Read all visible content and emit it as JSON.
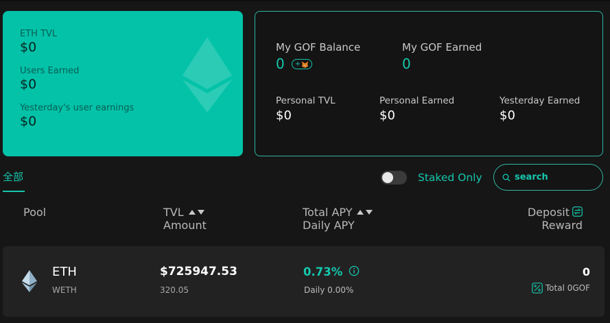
{
  "overview": {
    "eth_tvl_label": "ETH TVL",
    "eth_tvl_value": "$0",
    "users_earned_label": "Users Earned",
    "users_earned_value": "$0",
    "yesterday_label": "Yesterday's user earnings",
    "yesterday_value": "$0"
  },
  "account": {
    "gof_balance_label": "My GOF Balance",
    "gof_balance_value": "0",
    "add_token_label": "+",
    "gof_earned_label": "My GOF Earned",
    "gof_earned_value": "0",
    "personal_tvl_label": "Personal TVL",
    "personal_tvl_value": "$0",
    "personal_earned_label": "Personal Earned",
    "personal_earned_value": "$0",
    "yesterday_earned_label": "Yesterday Earned",
    "yesterday_earned_value": "$0"
  },
  "filters": {
    "tab_all": "全部",
    "staked_only_label": "Staked Only",
    "staked_only": false,
    "search_placeholder": "search"
  },
  "table": {
    "headers": {
      "pool": "Pool",
      "tvl": "TVL",
      "amount": "Amount",
      "total_apy": "Total APY",
      "daily_apy": "Daily APY",
      "deposit": "Deposit",
      "reward": "Reward"
    },
    "rows": [
      {
        "symbol": "ETH",
        "token": "WETH",
        "tvl": "$725947.53",
        "amount": "320.05",
        "total_apy": "0.73%",
        "daily_apy": "Daily 0.00%",
        "deposit": "0",
        "reward": "Total 0GOF"
      }
    ]
  },
  "colors": {
    "accent": "#16c7ad",
    "card_teal": "#03c2a8",
    "background": "#161616",
    "row_background": "#222222"
  },
  "icons": [
    "ethereum-watermark-icon",
    "metamask-fox-icon",
    "search-icon",
    "sort-icon",
    "swap-icon",
    "ethereum-icon",
    "info-icon",
    "percent-icon"
  ]
}
